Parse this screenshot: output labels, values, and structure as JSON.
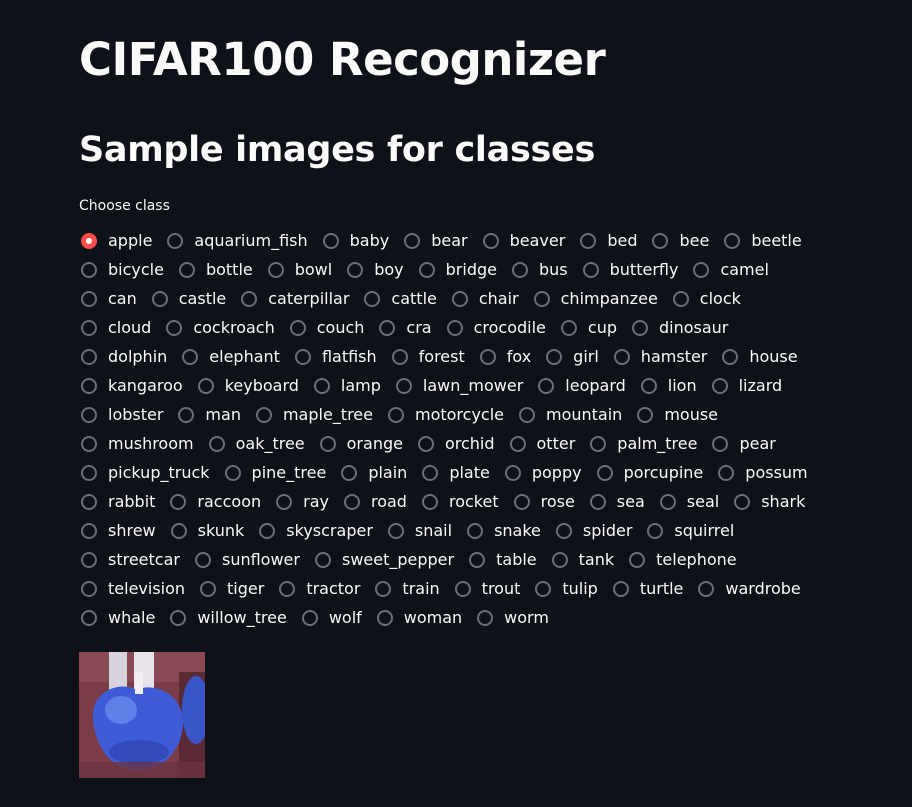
{
  "app": {
    "title": "CIFAR100 Recognizer",
    "subtitle": "Sample images for classes"
  },
  "class_picker": {
    "label": "Choose class",
    "selected": "apple",
    "accent_color": "#ff4b4b",
    "options": [
      "apple",
      "aquarium_fish",
      "baby",
      "bear",
      "beaver",
      "bed",
      "bee",
      "beetle",
      "bicycle",
      "bottle",
      "bowl",
      "boy",
      "bridge",
      "bus",
      "butterfly",
      "camel",
      "can",
      "castle",
      "caterpillar",
      "cattle",
      "chair",
      "chimpanzee",
      "clock",
      "cloud",
      "cockroach",
      "couch",
      "cra",
      "crocodile",
      "cup",
      "dinosaur",
      "dolphin",
      "elephant",
      "flatfish",
      "forest",
      "fox",
      "girl",
      "hamster",
      "house",
      "kangaroo",
      "keyboard",
      "lamp",
      "lawn_mower",
      "leopard",
      "lion",
      "lizard",
      "lobster",
      "man",
      "maple_tree",
      "motorcycle",
      "mountain",
      "mouse",
      "mushroom",
      "oak_tree",
      "orange",
      "orchid",
      "otter",
      "palm_tree",
      "pear",
      "pickup_truck",
      "pine_tree",
      "plain",
      "plate",
      "poppy",
      "porcupine",
      "possum",
      "rabbit",
      "raccoon",
      "ray",
      "road",
      "rocket",
      "rose",
      "sea",
      "seal",
      "shark",
      "shrew",
      "skunk",
      "skyscraper",
      "snail",
      "snake",
      "spider",
      "squirrel",
      "streetcar",
      "sunflower",
      "sweet_pepper",
      "table",
      "tank",
      "telephone",
      "television",
      "tiger",
      "tractor",
      "train",
      "trout",
      "tulip",
      "turtle",
      "wardrobe",
      "whale",
      "willow_tree",
      "wolf",
      "woman",
      "worm"
    ],
    "rows": [
      [
        "apple",
        "aquarium_fish",
        "baby",
        "bear",
        "beaver",
        "bed",
        "bee",
        "beetle"
      ],
      [
        "bicycle",
        "bottle",
        "bowl",
        "boy",
        "bridge",
        "bus",
        "butterfly",
        "camel"
      ],
      [
        "can",
        "castle",
        "caterpillar",
        "cattle",
        "chair",
        "chimpanzee",
        "clock"
      ],
      [
        "cloud",
        "cockroach",
        "couch",
        "cra",
        "crocodile",
        "cup",
        "dinosaur"
      ],
      [
        "dolphin",
        "elephant",
        "flatfish",
        "forest",
        "fox",
        "girl",
        "hamster",
        "house"
      ],
      [
        "kangaroo",
        "keyboard",
        "lamp",
        "lawn_mower",
        "leopard",
        "lion",
        "lizard"
      ],
      [
        "lobster",
        "man",
        "maple_tree",
        "motorcycle",
        "mountain",
        "mouse"
      ],
      [
        "mushroom",
        "oak_tree",
        "orange",
        "orchid",
        "otter",
        "palm_tree",
        "pear"
      ],
      [
        "pickup_truck",
        "pine_tree",
        "plain",
        "plate",
        "poppy",
        "porcupine",
        "possum"
      ],
      [
        "rabbit",
        "raccoon",
        "ray",
        "road",
        "rocket",
        "rose",
        "sea",
        "seal",
        "shark"
      ],
      [
        "shrew",
        "skunk",
        "skyscraper",
        "snail",
        "snake",
        "spider",
        "squirrel"
      ],
      [
        "streetcar",
        "sunflower",
        "sweet_pepper",
        "table",
        "tank",
        "telephone"
      ],
      [
        "television",
        "tiger",
        "tractor",
        "train",
        "trout",
        "tulip",
        "turtle",
        "wardrobe"
      ],
      [
        "whale",
        "willow_tree",
        "wolf",
        "woman",
        "worm"
      ]
    ]
  },
  "sample_image": {
    "class": "apple",
    "colors": {
      "background": "#7a3d47",
      "fruit": "#3f5bd6",
      "highlight": "#6f8ef0",
      "stem": "#e8e4ea"
    }
  }
}
